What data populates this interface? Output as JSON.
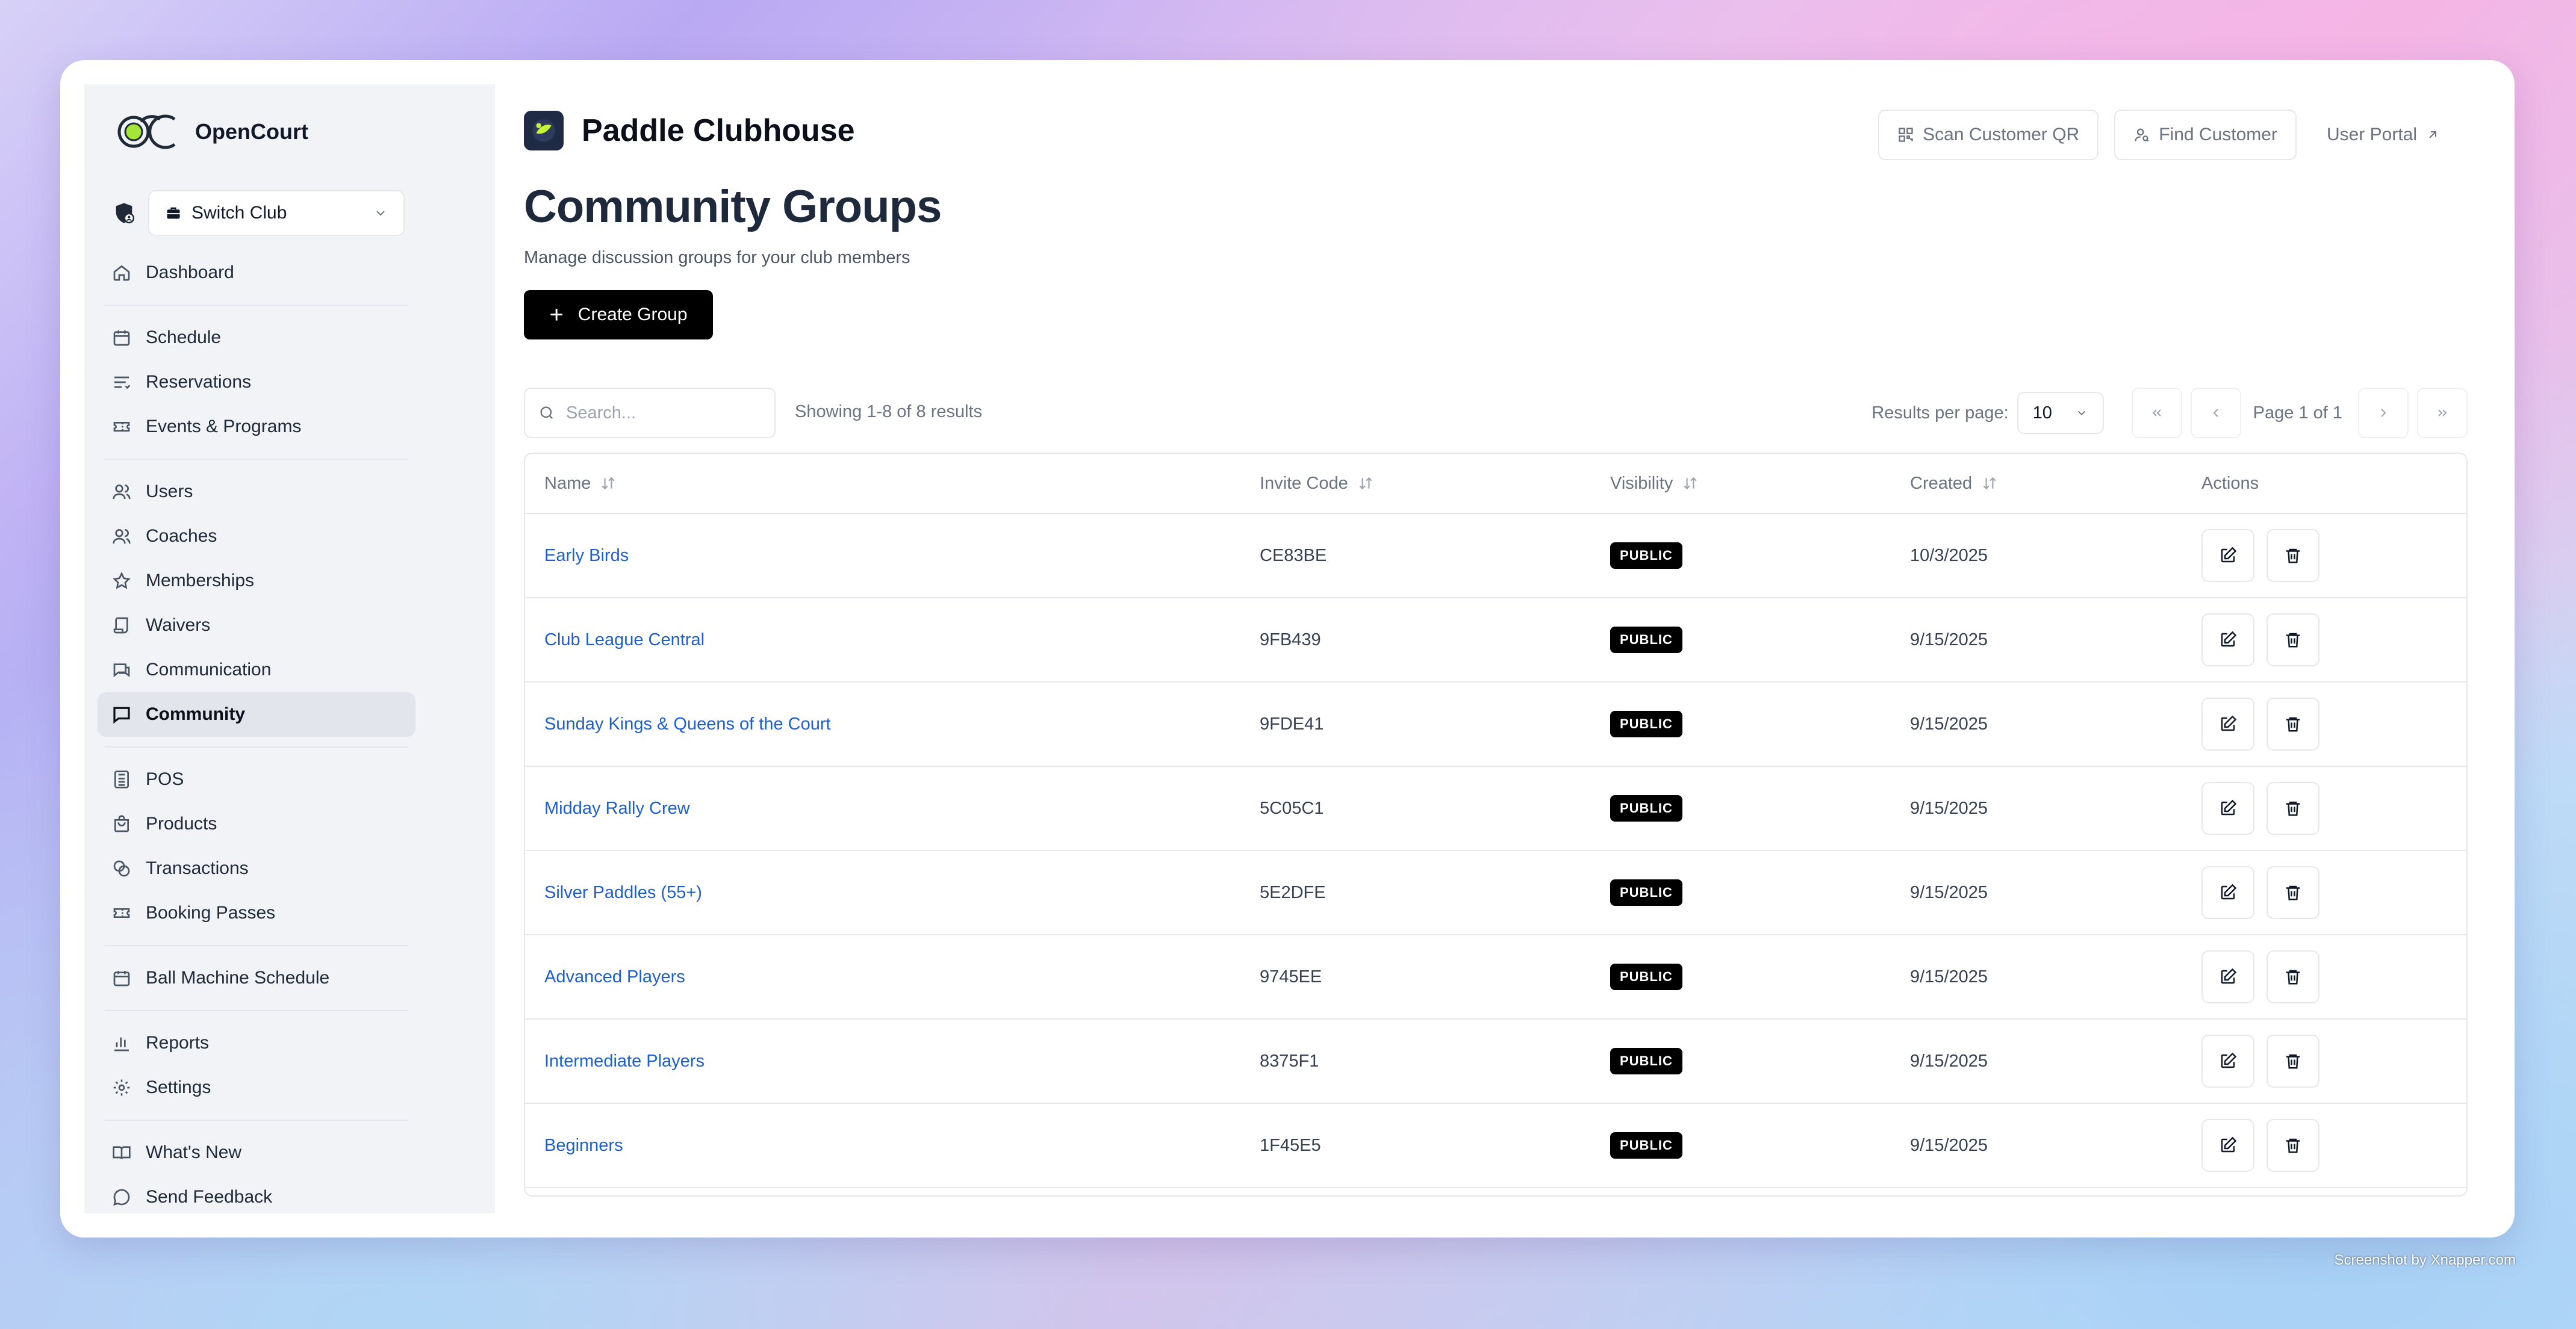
{
  "brand": {
    "name": "OpenCourt"
  },
  "switch_club": {
    "label": "Switch Club"
  },
  "nav": [
    {
      "label": "Dashboard",
      "icon": "home-icon"
    },
    {
      "label": "Schedule",
      "icon": "calendar-icon"
    },
    {
      "label": "Reservations",
      "icon": "list-icon"
    },
    {
      "label": "Events & Programs",
      "icon": "ticket-icon"
    },
    {
      "label": "Users",
      "icon": "users-icon"
    },
    {
      "label": "Coaches",
      "icon": "users-icon"
    },
    {
      "label": "Memberships",
      "icon": "star-icon"
    },
    {
      "label": "Waivers",
      "icon": "scroll-icon"
    },
    {
      "label": "Communication",
      "icon": "messages-icon"
    },
    {
      "label": "Community",
      "icon": "message-square-icon",
      "active": true
    },
    {
      "label": "POS",
      "icon": "calculator-icon"
    },
    {
      "label": "Products",
      "icon": "shopping-bag-icon"
    },
    {
      "label": "Transactions",
      "icon": "coins-icon"
    },
    {
      "label": "Booking Passes",
      "icon": "ticket-icon"
    },
    {
      "label": "Ball Machine Schedule",
      "icon": "calendar-icon"
    },
    {
      "label": "Reports",
      "icon": "bar-chart-icon"
    },
    {
      "label": "Settings",
      "icon": "gear-icon"
    },
    {
      "label": "What's New",
      "icon": "book-open-icon"
    },
    {
      "label": "Send Feedback",
      "icon": "message-circle-icon"
    }
  ],
  "header": {
    "club_name": "Paddle Clubhouse",
    "scan_label": "Scan Customer QR",
    "find_label": "Find Customer",
    "portal_label": "User Portal"
  },
  "page": {
    "title": "Community Groups",
    "subtitle": "Manage discussion groups for your club members",
    "create_label": "Create Group"
  },
  "toolbar": {
    "search_placeholder": "Search...",
    "showing": "Showing 1-8 of 8 results",
    "rpp_label": "Results per page:",
    "rpp_value": "10",
    "page_label": "Page 1 of 1"
  },
  "table": {
    "columns": [
      "Name",
      "Invite Code",
      "Visibility",
      "Created",
      "Actions"
    ],
    "rows": [
      {
        "name": "Early Birds",
        "code": "CE83BE",
        "visibility": "PUBLIC",
        "created": "10/3/2025"
      },
      {
        "name": "Club League Central",
        "code": "9FB439",
        "visibility": "PUBLIC",
        "created": "9/15/2025"
      },
      {
        "name": "Sunday Kings & Queens of the Court",
        "code": "9FDE41",
        "visibility": "PUBLIC",
        "created": "9/15/2025"
      },
      {
        "name": "Midday Rally Crew",
        "code": "5C05C1",
        "visibility": "PUBLIC",
        "created": "9/15/2025"
      },
      {
        "name": "Silver Paddles (55+)",
        "code": "5E2DFE",
        "visibility": "PUBLIC",
        "created": "9/15/2025"
      },
      {
        "name": "Advanced Players",
        "code": "9745EE",
        "visibility": "PUBLIC",
        "created": "9/15/2025"
      },
      {
        "name": "Intermediate Players",
        "code": "8375F1",
        "visibility": "PUBLIC",
        "created": "9/15/2025"
      },
      {
        "name": "Beginners",
        "code": "1F45E5",
        "visibility": "PUBLIC",
        "created": "9/15/2025"
      }
    ]
  },
  "watermark": "Screenshot by Xnapper.com",
  "colors": {
    "link": "#1d5fd0",
    "accent": "#000000",
    "brand_green": "#a3e635"
  }
}
